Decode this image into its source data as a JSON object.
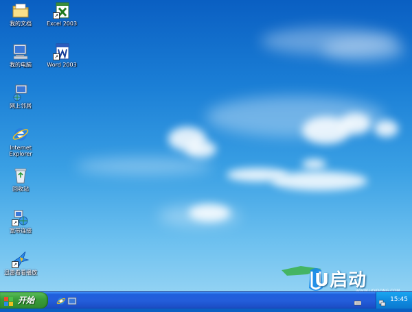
{
  "desktop": {
    "icons": [
      {
        "label": "我的文档"
      },
      {
        "label": "Excel 2003"
      },
      {
        "label": "我的电脑"
      },
      {
        "label": "Word 2003"
      },
      {
        "label": "网上邻居"
      },
      {
        "label": "Internet Explorer"
      },
      {
        "label": "回收站"
      },
      {
        "label": "宽带连接"
      },
      {
        "label": "迅雷看看播放"
      }
    ]
  },
  "taskbar": {
    "start_label": "开始",
    "clock": "15:45",
    "quick_launch": [
      "ie-icon",
      "show-desktop-icon"
    ]
  },
  "watermark": {
    "brand": "U启动",
    "url": "WWW.UQIDONG.COM"
  },
  "colors": {
    "taskbar": "#245edb",
    "start_button": "#3a9e3a",
    "tray": "#0f8be0",
    "sky_top": "#0a5fc2",
    "sky_bottom": "#9ed8f5"
  }
}
